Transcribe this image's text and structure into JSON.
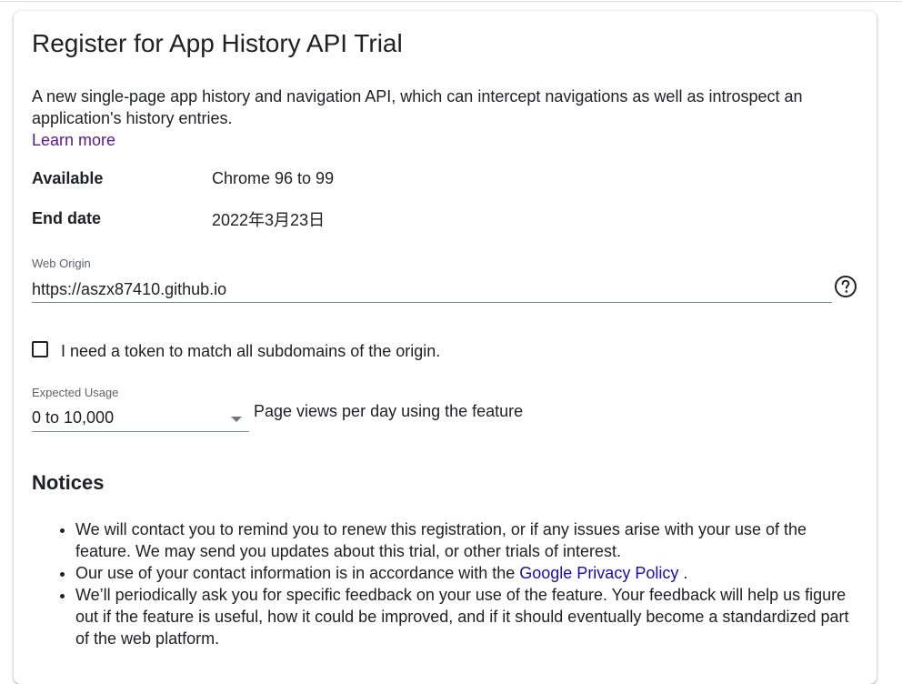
{
  "form": {
    "title": "Register for App History API Trial",
    "description": "A new single-page app history and navigation API, which can intercept navigations as well as introspect an application's history entries.",
    "learn_more": "Learn more",
    "available_label": "Available",
    "available_value": "Chrome 96 to 99",
    "end_date_label": "End date",
    "end_date_value": "2022年3月23日",
    "web_origin": {
      "label": "Web Origin",
      "value": "https://aszx87410.github.io",
      "help_icon": "help-circle-icon"
    },
    "subdomain_checkbox": {
      "label": "I need a token to match all subdomains of the origin.",
      "checked": false
    },
    "expected_usage": {
      "label": "Expected Usage",
      "selected": "0 to 10,000",
      "suffix": "Page views per day using the feature"
    }
  },
  "notices": {
    "heading": "Notices",
    "item1": "We will contact you to remind you to renew this registration, or if any issues arise with your use of the feature. We may send you updates about this trial, or other trials of interest.",
    "item2_prefix": "Our use of your contact information is in accordance with the",
    "item2_link": "Google Privacy Policy",
    "item2_suffix": ".",
    "item3": "We’ll periodically ask you for specific feedback on your use of the feature. Your feedback will help us figure out if the feature is useful, how it could be improved, and if it should eventually become a standardized part of the web platform."
  },
  "colors": {
    "link_visited": "#551a8b",
    "link": "#1a0dab",
    "text": "#202124",
    "muted": "#5f6368"
  }
}
